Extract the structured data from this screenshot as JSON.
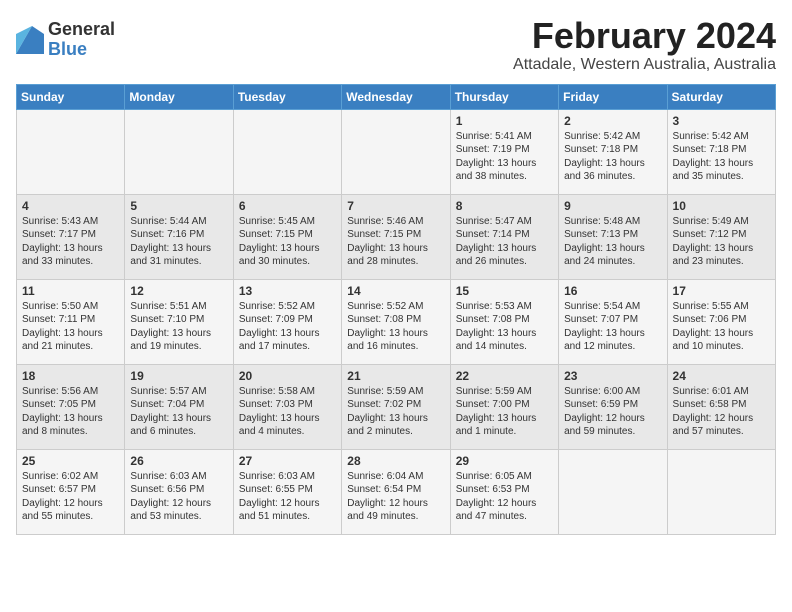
{
  "logo": {
    "general": "General",
    "blue": "Blue"
  },
  "title": "February 2024",
  "subtitle": "Attadale, Western Australia, Australia",
  "days_of_week": [
    "Sunday",
    "Monday",
    "Tuesday",
    "Wednesday",
    "Thursday",
    "Friday",
    "Saturday"
  ],
  "weeks": [
    [
      {
        "day": "",
        "content": ""
      },
      {
        "day": "",
        "content": ""
      },
      {
        "day": "",
        "content": ""
      },
      {
        "day": "",
        "content": ""
      },
      {
        "day": "1",
        "content": "Sunrise: 5:41 AM\nSunset: 7:19 PM\nDaylight: 13 hours\nand 38 minutes."
      },
      {
        "day": "2",
        "content": "Sunrise: 5:42 AM\nSunset: 7:18 PM\nDaylight: 13 hours\nand 36 minutes."
      },
      {
        "day": "3",
        "content": "Sunrise: 5:42 AM\nSunset: 7:18 PM\nDaylight: 13 hours\nand 35 minutes."
      }
    ],
    [
      {
        "day": "4",
        "content": "Sunrise: 5:43 AM\nSunset: 7:17 PM\nDaylight: 13 hours\nand 33 minutes."
      },
      {
        "day": "5",
        "content": "Sunrise: 5:44 AM\nSunset: 7:16 PM\nDaylight: 13 hours\nand 31 minutes."
      },
      {
        "day": "6",
        "content": "Sunrise: 5:45 AM\nSunset: 7:15 PM\nDaylight: 13 hours\nand 30 minutes."
      },
      {
        "day": "7",
        "content": "Sunrise: 5:46 AM\nSunset: 7:15 PM\nDaylight: 13 hours\nand 28 minutes."
      },
      {
        "day": "8",
        "content": "Sunrise: 5:47 AM\nSunset: 7:14 PM\nDaylight: 13 hours\nand 26 minutes."
      },
      {
        "day": "9",
        "content": "Sunrise: 5:48 AM\nSunset: 7:13 PM\nDaylight: 13 hours\nand 24 minutes."
      },
      {
        "day": "10",
        "content": "Sunrise: 5:49 AM\nSunset: 7:12 PM\nDaylight: 13 hours\nand 23 minutes."
      }
    ],
    [
      {
        "day": "11",
        "content": "Sunrise: 5:50 AM\nSunset: 7:11 PM\nDaylight: 13 hours\nand 21 minutes."
      },
      {
        "day": "12",
        "content": "Sunrise: 5:51 AM\nSunset: 7:10 PM\nDaylight: 13 hours\nand 19 minutes."
      },
      {
        "day": "13",
        "content": "Sunrise: 5:52 AM\nSunset: 7:09 PM\nDaylight: 13 hours\nand 17 minutes."
      },
      {
        "day": "14",
        "content": "Sunrise: 5:52 AM\nSunset: 7:08 PM\nDaylight: 13 hours\nand 16 minutes."
      },
      {
        "day": "15",
        "content": "Sunrise: 5:53 AM\nSunset: 7:08 PM\nDaylight: 13 hours\nand 14 minutes."
      },
      {
        "day": "16",
        "content": "Sunrise: 5:54 AM\nSunset: 7:07 PM\nDaylight: 13 hours\nand 12 minutes."
      },
      {
        "day": "17",
        "content": "Sunrise: 5:55 AM\nSunset: 7:06 PM\nDaylight: 13 hours\nand 10 minutes."
      }
    ],
    [
      {
        "day": "18",
        "content": "Sunrise: 5:56 AM\nSunset: 7:05 PM\nDaylight: 13 hours\nand 8 minutes."
      },
      {
        "day": "19",
        "content": "Sunrise: 5:57 AM\nSunset: 7:04 PM\nDaylight: 13 hours\nand 6 minutes."
      },
      {
        "day": "20",
        "content": "Sunrise: 5:58 AM\nSunset: 7:03 PM\nDaylight: 13 hours\nand 4 minutes."
      },
      {
        "day": "21",
        "content": "Sunrise: 5:59 AM\nSunset: 7:02 PM\nDaylight: 13 hours\nand 2 minutes."
      },
      {
        "day": "22",
        "content": "Sunrise: 5:59 AM\nSunset: 7:00 PM\nDaylight: 13 hours\nand 1 minute."
      },
      {
        "day": "23",
        "content": "Sunrise: 6:00 AM\nSunset: 6:59 PM\nDaylight: 12 hours\nand 59 minutes."
      },
      {
        "day": "24",
        "content": "Sunrise: 6:01 AM\nSunset: 6:58 PM\nDaylight: 12 hours\nand 57 minutes."
      }
    ],
    [
      {
        "day": "25",
        "content": "Sunrise: 6:02 AM\nSunset: 6:57 PM\nDaylight: 12 hours\nand 55 minutes."
      },
      {
        "day": "26",
        "content": "Sunrise: 6:03 AM\nSunset: 6:56 PM\nDaylight: 12 hours\nand 53 minutes."
      },
      {
        "day": "27",
        "content": "Sunrise: 6:03 AM\nSunset: 6:55 PM\nDaylight: 12 hours\nand 51 minutes."
      },
      {
        "day": "28",
        "content": "Sunrise: 6:04 AM\nSunset: 6:54 PM\nDaylight: 12 hours\nand 49 minutes."
      },
      {
        "day": "29",
        "content": "Sunrise: 6:05 AM\nSunset: 6:53 PM\nDaylight: 12 hours\nand 47 minutes."
      },
      {
        "day": "",
        "content": ""
      },
      {
        "day": "",
        "content": ""
      }
    ]
  ]
}
